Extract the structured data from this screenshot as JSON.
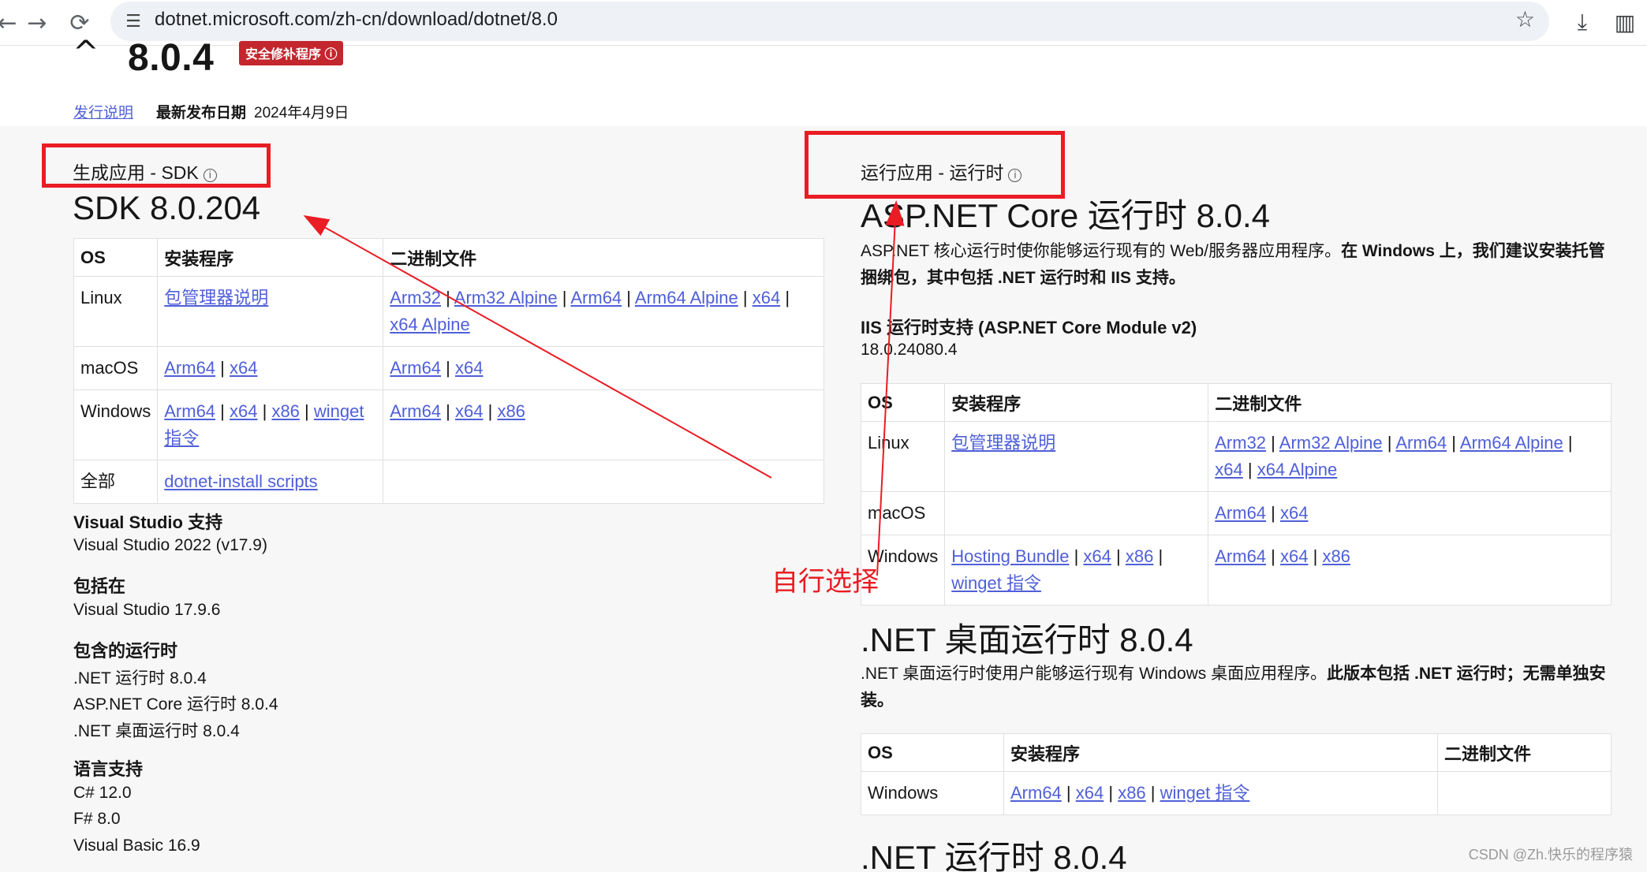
{
  "browser": {
    "back_icon": "←",
    "forward_icon": "→",
    "reload_icon": "⟳",
    "site_icon": "☰",
    "url": "dotnet.microsoft.com/zh-cn/download/dotnet/8.0",
    "star_icon": "☆",
    "download_icon": "⤓",
    "sidebar_icon": "▥"
  },
  "header": {
    "version": "8.0.4",
    "security_badge": "安全修补程序 ⓘ",
    "release_notes": "发行说明",
    "release_date_label": "最新发布日期",
    "release_date": "2024年4月9日"
  },
  "sdk": {
    "column_label": "生成应用 - SDK",
    "title": "SDK 8.0.204",
    "table": {
      "headers": [
        "OS",
        "安装程序",
        "二进制文件"
      ],
      "rows": [
        {
          "os": "Linux",
          "installers": [
            "包管理器说明"
          ],
          "binaries": [
            "Arm32",
            "Arm32 Alpine",
            "Arm64",
            "Arm64 Alpine",
            "x64",
            "x64 Alpine"
          ]
        },
        {
          "os": "macOS",
          "installers": [
            "Arm64",
            "x64"
          ],
          "binaries": [
            "Arm64",
            "x64"
          ]
        },
        {
          "os": "Windows",
          "installers": [
            "Arm64",
            "x64",
            "x86",
            "winget 指令"
          ],
          "binaries": [
            "Arm64",
            "x64",
            "x86"
          ]
        },
        {
          "os": "全部",
          "installers": [
            "dotnet-install scripts"
          ],
          "binaries": []
        }
      ]
    },
    "vs_support_label": "Visual Studio 支持",
    "vs_support_value": "Visual Studio 2022 (v17.9)",
    "included_in_label": "包括在",
    "included_in_value": "Visual Studio 17.9.6",
    "runtimes_label": "包含的运行时",
    "runtimes": [
      ".NET 运行时 8.0.4",
      "ASP.NET Core 运行时 8.0.4",
      ".NET 桌面运行时 8.0.4"
    ],
    "languages_label": "语言支持",
    "languages": [
      "C# 12.0",
      "F# 8.0",
      "Visual Basic 16.9"
    ]
  },
  "runtime": {
    "column_label": "运行应用 - 运行时",
    "aspnet_title": "ASP.NET Core 运行时 8.0.4",
    "aspnet_desc_plain": "ASP.NET 核心运行时使你能够运行现有的 Web/服务器应用程序。",
    "aspnet_desc_bold": "在 Windows 上，我们建议安装托管捆绑包，其中包括 .NET 运行时和 IIS 支持。",
    "iis_label": "IIS 运行时支持 (ASP.NET Core Module v2)",
    "iis_version": "18.0.24080.4",
    "aspnet_table": {
      "headers": [
        "OS",
        "安装程序",
        "二进制文件"
      ],
      "rows": [
        {
          "os": "Linux",
          "installers": [
            "包管理器说明"
          ],
          "binaries": [
            "Arm32",
            "Arm32 Alpine",
            "Arm64",
            "Arm64 Alpine",
            "x64",
            "x64 Alpine"
          ]
        },
        {
          "os": "macOS",
          "installers": [],
          "binaries": [
            "Arm64",
            "x64"
          ]
        },
        {
          "os": "Windows",
          "installers": [
            "Hosting Bundle",
            "x64",
            "x86",
            "winget 指令"
          ],
          "binaries": [
            "Arm64",
            "x64",
            "x86"
          ]
        }
      ]
    },
    "desktop_title": ".NET 桌面运行时 8.0.4",
    "desktop_desc_plain": ".NET 桌面运行时使用户能够运行现有 Windows 桌面应用程序。",
    "desktop_desc_bold": "此版本包括 .NET 运行时；无需单独安装。",
    "desktop_table": {
      "headers": [
        "OS",
        "安装程序",
        "二进制文件"
      ],
      "rows": [
        {
          "os": "Windows",
          "installers": [
            "Arm64",
            "x64",
            "x86",
            "winget 指令"
          ],
          "binaries": []
        }
      ]
    },
    "netrt_title": ".NET 运行时 8.0.4"
  },
  "annotations": {
    "note": "自行选择",
    "color": "#ea1c24"
  },
  "watermark": "CSDN @Zh.快乐的程序猿"
}
